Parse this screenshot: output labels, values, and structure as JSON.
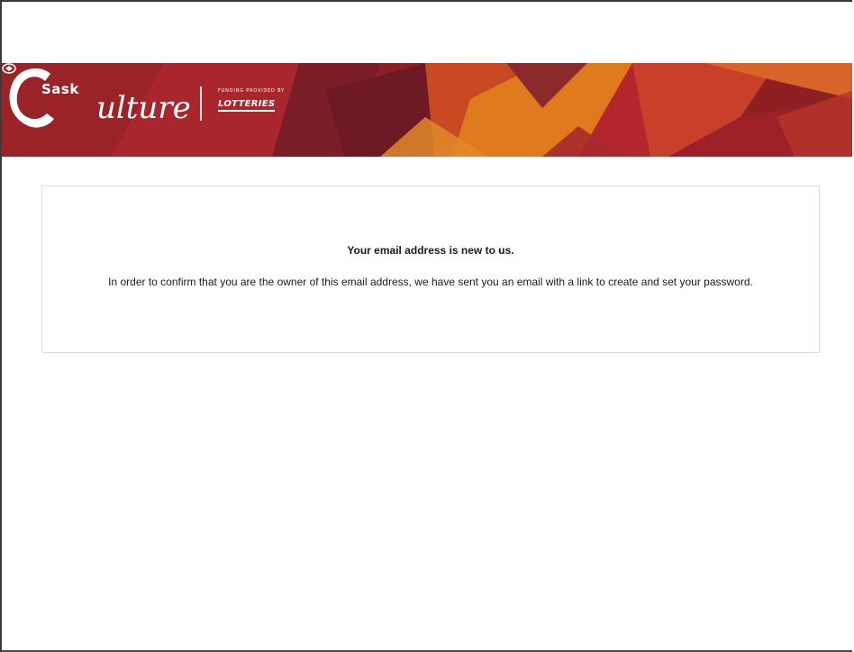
{
  "header": {
    "logo": {
      "sask": "Sask",
      "culture_c": "C",
      "culture_rest": "ulture",
      "funding_text": "FUNDING PROVIDED BY",
      "lotteries_text": "LOTTERIES"
    },
    "colors": {
      "banner_dark": "#8e1f22",
      "banner_red": "#b3262b",
      "banner_orange": "#e07a1e",
      "banner_maroon": "#6e1a24"
    }
  },
  "message": {
    "title": "Your email address is new to us.",
    "body": "In order to confirm that you are the owner of this email address, we have sent you an email with a link to create and set your password."
  }
}
